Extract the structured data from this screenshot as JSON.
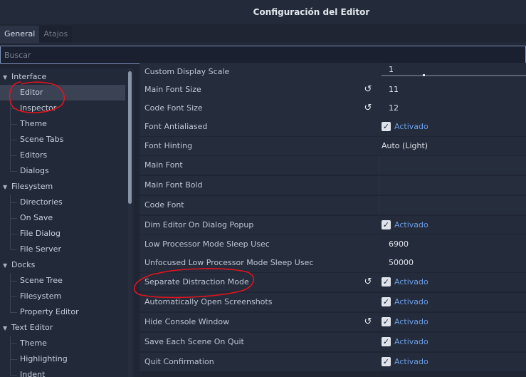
{
  "window": {
    "title": "Configuración del Editor"
  },
  "tabs": [
    {
      "label": "General",
      "active": true
    },
    {
      "label": "Atajos",
      "active": false
    }
  ],
  "search": {
    "placeholder": "Buscar"
  },
  "tree": {
    "sections": [
      {
        "label": "Interface",
        "children": [
          "Editor",
          "Inspector",
          "Theme",
          "Scene Tabs",
          "Editors",
          "Dialogs"
        ]
      },
      {
        "label": "Filesystem",
        "children": [
          "Directories",
          "On Save",
          "File Dialog",
          "File Server"
        ]
      },
      {
        "label": "Docks",
        "children": [
          "Scene Tree",
          "Filesystem",
          "Property Editor"
        ]
      },
      {
        "label": "Text Editor",
        "children": [
          "Theme",
          "Highlighting",
          "Indent"
        ]
      }
    ],
    "selected": "Editor"
  },
  "properties": [
    {
      "name": "Custom Display Scale",
      "type": "slider",
      "value": "1",
      "revert": false
    },
    {
      "name": "Main Font Size",
      "type": "number",
      "value": "11",
      "revert": true
    },
    {
      "name": "Code Font Size",
      "type": "number",
      "value": "12",
      "revert": true
    },
    {
      "name": "Font Antialiased",
      "type": "check",
      "value": "Activado",
      "revert": false
    },
    {
      "name": "Font Hinting",
      "type": "enum",
      "value": "Auto (Light)",
      "revert": false
    },
    {
      "name": "Main Font",
      "type": "empty",
      "value": "",
      "revert": false
    },
    {
      "name": "Main Font Bold",
      "type": "empty",
      "value": "",
      "revert": false
    },
    {
      "name": "Code Font",
      "type": "empty",
      "value": "",
      "revert": false
    },
    {
      "name": "Dim Editor On Dialog Popup",
      "type": "check",
      "value": "Activado",
      "revert": false
    },
    {
      "name": "Low Processor Mode Sleep Usec",
      "type": "number",
      "value": "6900",
      "revert": false
    },
    {
      "name": "Unfocused Low Processor Mode Sleep Usec",
      "type": "number",
      "value": "50000",
      "revert": false
    },
    {
      "name": "Separate Distraction Mode",
      "type": "check",
      "value": "Activado",
      "revert": true
    },
    {
      "name": "Automatically Open Screenshots",
      "type": "check",
      "value": "Activado",
      "revert": false
    },
    {
      "name": "Hide Console Window",
      "type": "check",
      "value": "Activado",
      "revert": true
    },
    {
      "name": "Save Each Scene On Quit",
      "type": "check",
      "value": "Activado",
      "revert": false
    },
    {
      "name": "Quit Confirmation",
      "type": "check",
      "value": "Activado",
      "revert": false
    }
  ],
  "colors": {
    "background": "#1f2533",
    "accent_text": "#6b9fe8",
    "annotation": "#e0141e"
  }
}
